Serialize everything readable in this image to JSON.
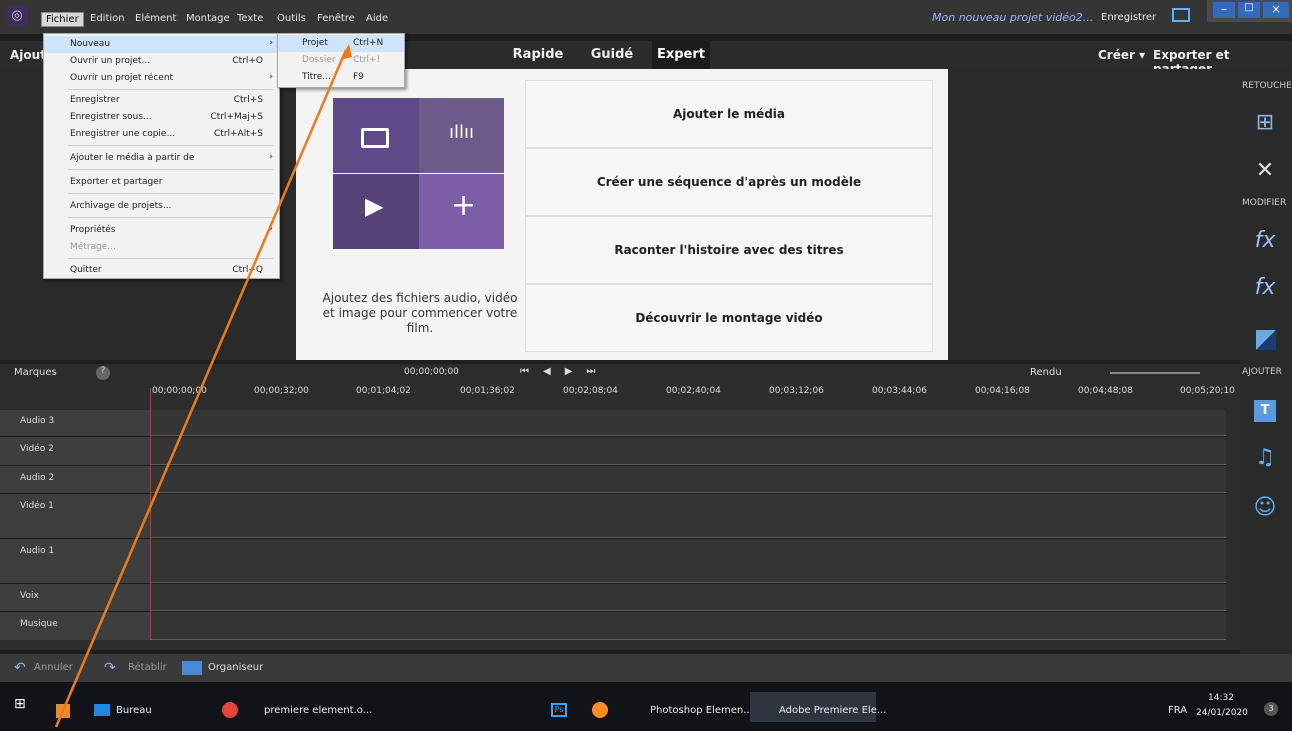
{
  "menubar": {
    "items": [
      "Fichier",
      "Edition",
      "Elément",
      "Montage",
      "Texte",
      "Outils",
      "Fenêtre",
      "Aide"
    ],
    "project_title": "Mon nouveau projet vidéo2...",
    "save_label": "Enregistrer"
  },
  "toolbar": {
    "left_label": "Ajout",
    "tabs": [
      "Rapide",
      "Guidé",
      "Expert"
    ],
    "create_label": "Créer ▾",
    "export_label": "Exporter et partager"
  },
  "file_menu": {
    "items": [
      {
        "label": "Nouveau",
        "shortcut": "",
        "submenu": true
      },
      {
        "label": "Ouvrir un projet...",
        "shortcut": "Ctrl+O"
      },
      {
        "label": "Ouvrir un projet récent",
        "shortcut": "",
        "submenu": true
      },
      {
        "label": "Enregistrer",
        "shortcut": "Ctrl+S"
      },
      {
        "label": "Enregistrer sous...",
        "shortcut": "Ctrl+Maj+S"
      },
      {
        "label": "Enregistrer une copie...",
        "shortcut": "Ctrl+Alt+S"
      },
      {
        "label": "Ajouter le média à partir de",
        "shortcut": "",
        "submenu": true
      },
      {
        "label": "Exporter et partager",
        "shortcut": ""
      },
      {
        "label": "Archivage de projets...",
        "shortcut": ""
      },
      {
        "label": "Propriétés",
        "shortcut": "",
        "submenu": true
      },
      {
        "label": "Métrage...",
        "shortcut": ""
      },
      {
        "label": "Quitter",
        "shortcut": "Ctrl+Q"
      }
    ]
  },
  "submenu": {
    "items": [
      {
        "label": "Projet",
        "shortcut": "Ctrl+N"
      },
      {
        "label": "Dossier",
        "shortcut": "Ctrl+!"
      },
      {
        "label": "Titre...",
        "shortcut": "F9"
      }
    ]
  },
  "start_panel": {
    "actions": [
      "Ajouter le média",
      "Créer une séquence d'après un modèle",
      "Raconter l'histoire avec des titres",
      "Découvrir le montage vidéo"
    ],
    "hint": "Ajoutez des fichiers audio, vidéo et image pour commencer votre film."
  },
  "right_panel": {
    "sections": [
      "RETOUCHE",
      "MODIFIER",
      "AJOUTER"
    ]
  },
  "timeline": {
    "markers_label": "Marques",
    "timecode": "00;00;00;00",
    "render_label": "Rendu",
    "ruler": [
      "00;00;00;00",
      "00;00;32;00",
      "00;01;04;02",
      "00;01;36;02",
      "00;02;08;04",
      "00;02;40;04",
      "00;03;12;06",
      "00;03;44;06",
      "00;04;16;08",
      "00;04;48;08",
      "00;05;20;10"
    ],
    "tracks": [
      "Audio 3",
      "Vidéo 2",
      "Audio 2",
      "Vidéo 1",
      "Audio 1",
      "Voix",
      "Musique"
    ]
  },
  "bottom": {
    "undo": "Annuler",
    "redo": "Rétablir",
    "organizer": "Organiseur"
  },
  "taskbar": {
    "items": [
      "Bureau",
      "premiere element.o...",
      "Photoshop Elemen...",
      "Adobe Premiere Ele..."
    ],
    "lang": "FRA",
    "time": "14:32",
    "date": "24/01/2020",
    "badge": "3"
  },
  "colors": {
    "accent": "#7a5ea8",
    "arrow": "#f07a1a"
  }
}
